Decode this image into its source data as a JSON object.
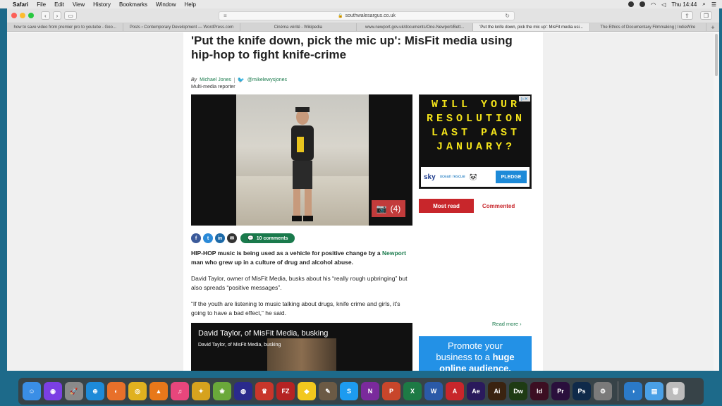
{
  "menubar": {
    "app": "Safari",
    "items": [
      "File",
      "Edit",
      "View",
      "History",
      "Bookmarks",
      "Window",
      "Help"
    ],
    "clock": "Thu 14:44"
  },
  "browser": {
    "url": "southwalesargus.co.uk",
    "tabs": [
      {
        "label": "how to save video from premier pro to youtube - Goo...",
        "active": false
      },
      {
        "label": "Posts ‹ Contemporary Development — WordPress.com",
        "active": false
      },
      {
        "label": "Cinéma vérité - Wikipedia",
        "active": false
      },
      {
        "label": "www.newport.gov.uk/documents/One-Newport/Bett...",
        "active": false
      },
      {
        "label": "'Put the knife down, pick the mic up': MisFit media usi...",
        "active": true
      },
      {
        "label": "The Ethics of Documentary Filmmaking | IndieWire",
        "active": false
      }
    ]
  },
  "article": {
    "headline": "'Put the knife down, pick the mic up': MisFit media using hip-hop to fight knife-crime",
    "by": "By",
    "author": "Michael Jones",
    "twitter_handle": "@mikelewysjones",
    "role": "Multi-media reporter",
    "photo_count": "(4)",
    "comments_label": "10 comments",
    "lead_bold": "HIP-HOP music is being used as a vehicle for positive change by a",
    "lead_link": "Newport",
    "lead_rest": "man who grew up in a culture of drug and alcohol abuse.",
    "para2": "David Taylor, owner of MisFit Media, busks about his “really rough upbringing” but also spreads “positive messages”.",
    "para3": "“If the youth are listening to music talking about drugs, knife crime and girls, it’s going to have a bad effect,” he said.",
    "video_title": "David Taylor, of MisFit Media, busking",
    "video_subtitle": "David Taylor, of MisFit Media, busking"
  },
  "sidebar": {
    "ad_text": "WILL YOUR RESOLUTION LAST PAST JANUARY?",
    "ad_sky": "sky",
    "ad_ocean": "ocean rescue",
    "ad_pledge": "PLEDGE",
    "tab_most_read": "Most read",
    "tab_commented": "Commented",
    "read_more": "Read more ›",
    "promo_line1": "Promote your",
    "promo_line2": "business to a",
    "promo_bold2": "huge",
    "promo_line3": "online audience."
  },
  "dock": [
    {
      "name": "finder",
      "color": "#3a8ee6",
      "glyph": "☺"
    },
    {
      "name": "siri",
      "color": "#7b3fe4",
      "glyph": "◉"
    },
    {
      "name": "launchpad",
      "color": "#8a8a8a",
      "glyph": "🚀"
    },
    {
      "name": "safari",
      "color": "#1d8ad8",
      "glyph": "⊕"
    },
    {
      "name": "firefox",
      "color": "#e8702a",
      "glyph": "◐"
    },
    {
      "name": "chrome",
      "color": "#e0b11f",
      "glyph": "◎"
    },
    {
      "name": "vlc",
      "color": "#e8781a",
      "glyph": "▲"
    },
    {
      "name": "itunes",
      "color": "#e8467c",
      "glyph": "♫"
    },
    {
      "name": "app-9",
      "color": "#d6a21e",
      "glyph": "✦"
    },
    {
      "name": "app-10",
      "color": "#6aa83a",
      "glyph": "❀"
    },
    {
      "name": "audio",
      "color": "#2a2a8c",
      "glyph": "◍"
    },
    {
      "name": "app-12",
      "color": "#c8362b",
      "glyph": "♛"
    },
    {
      "name": "filezilla",
      "color": "#b52323",
      "glyph": "FZ"
    },
    {
      "name": "cyberduck",
      "color": "#f2c81e",
      "glyph": "◆"
    },
    {
      "name": "gimp",
      "color": "#6b5a45",
      "glyph": "✎"
    },
    {
      "name": "skype",
      "color": "#1d9bf0",
      "glyph": "S"
    },
    {
      "name": "onenote",
      "color": "#7a2a9c",
      "glyph": "N"
    },
    {
      "name": "powerpoint",
      "color": "#c8462b",
      "glyph": "P"
    },
    {
      "name": "excel",
      "color": "#1d7a45",
      "glyph": "X"
    },
    {
      "name": "word",
      "color": "#2b5aa8",
      "glyph": "W"
    },
    {
      "name": "acrobat",
      "color": "#c8262b",
      "glyph": "A"
    },
    {
      "name": "after-effects",
      "color": "#2a1a5c",
      "glyph": "Ae"
    },
    {
      "name": "illustrator",
      "color": "#3a2310",
      "glyph": "Ai"
    },
    {
      "name": "dreamweaver",
      "color": "#1e3b14",
      "glyph": "Dw"
    },
    {
      "name": "indesign",
      "color": "#3c0f22",
      "glyph": "Id"
    },
    {
      "name": "premiere",
      "color": "#2a0f3c",
      "glyph": "Pr"
    },
    {
      "name": "photoshop",
      "color": "#0f2a4a",
      "glyph": "Ps"
    },
    {
      "name": "system-prefs",
      "color": "#7a7a7a",
      "glyph": "⚙"
    },
    {
      "name": "network",
      "color": "#2b7ac8",
      "glyph": "◑"
    },
    {
      "name": "folder",
      "color": "#4aa0e6",
      "glyph": "▤"
    },
    {
      "name": "trash",
      "color": "#bcbcbc",
      "glyph": "🗑"
    }
  ]
}
